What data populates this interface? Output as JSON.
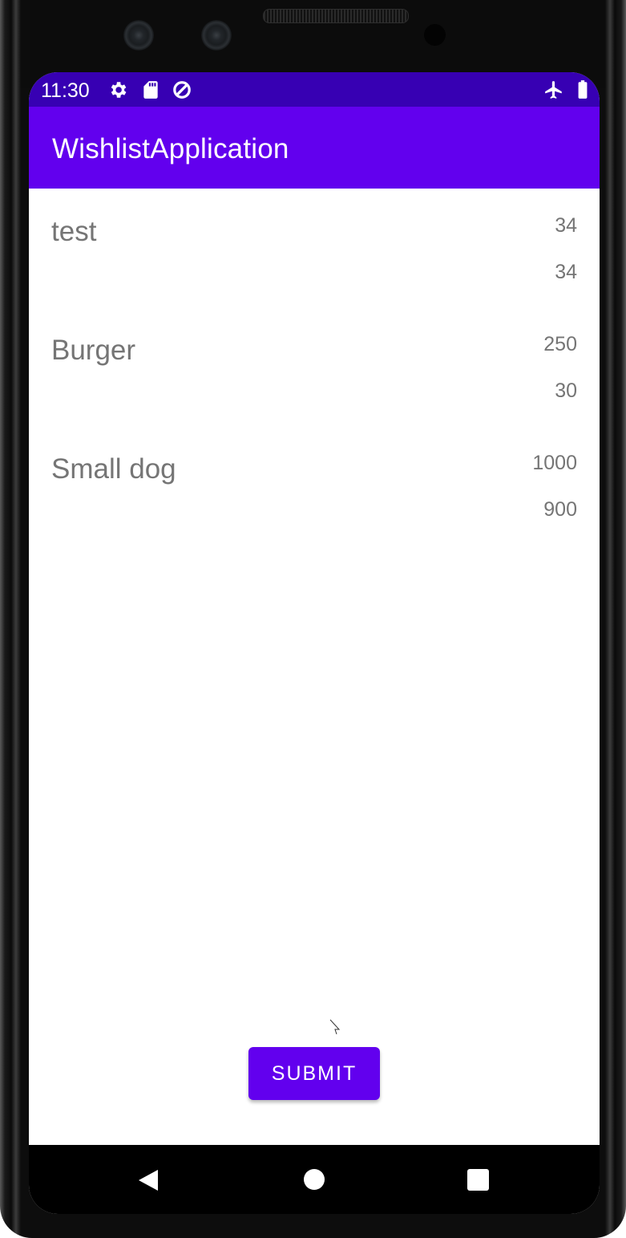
{
  "status_bar": {
    "time": "11:30",
    "left_icons": [
      "gear-icon",
      "sd-card-icon",
      "data-saver-icon"
    ],
    "right_icons": [
      "airplane-mode-icon",
      "battery-icon"
    ]
  },
  "app_bar": {
    "title": "WishlistApplication"
  },
  "items": [
    {
      "name": "test",
      "price": "34",
      "quantity": "34"
    },
    {
      "name": "Burger",
      "price": "250",
      "quantity": "30"
    },
    {
      "name": "Small dog",
      "price": "1000",
      "quantity": "900"
    }
  ],
  "submit_button": {
    "label": "SUBMIT"
  },
  "nav_bar": {
    "buttons": [
      "back-icon",
      "home-icon",
      "recents-icon"
    ]
  },
  "colors": {
    "status_bar": "#3700b3",
    "app_bar": "#6200ee",
    "button": "#6200ee",
    "item_text": "#757575"
  }
}
